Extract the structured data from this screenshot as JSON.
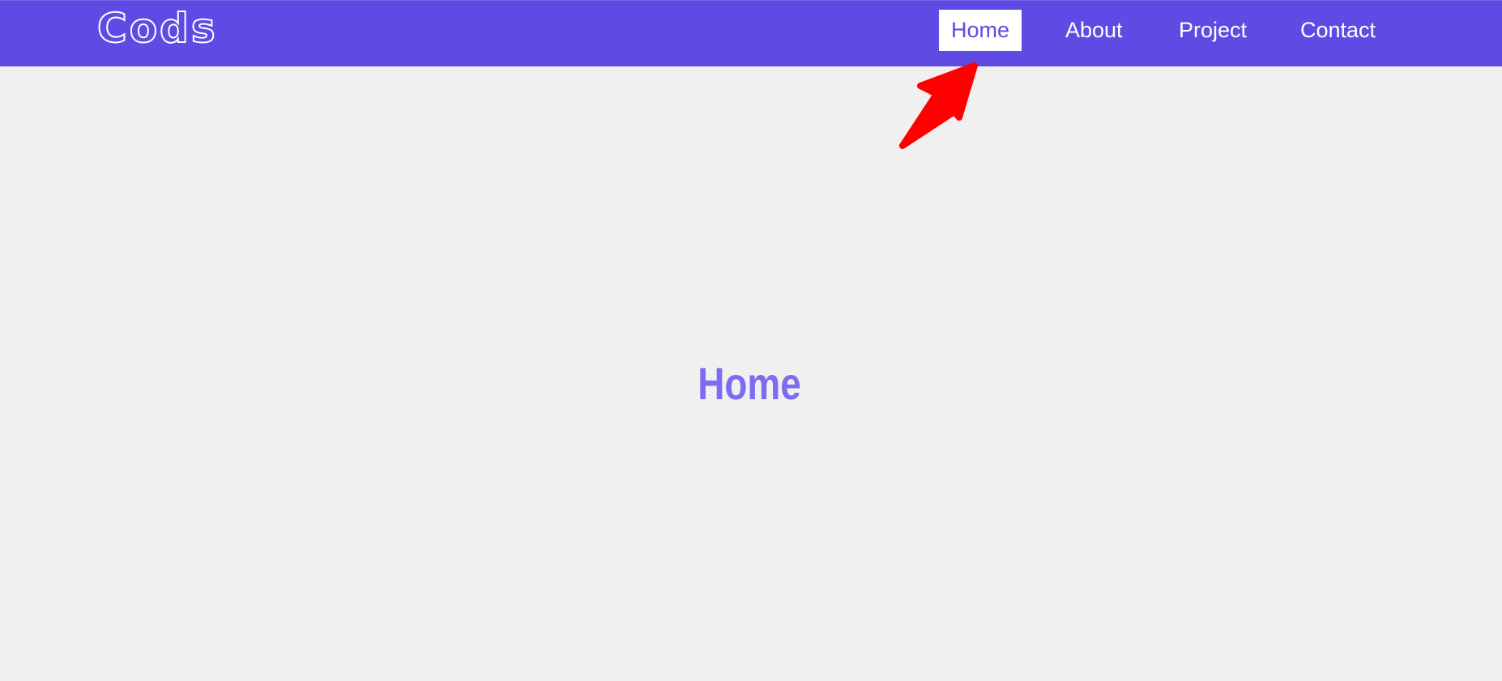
{
  "brand": {
    "logo_text": "Cods"
  },
  "nav": {
    "items": [
      {
        "label": "Home",
        "active": true
      },
      {
        "label": "About",
        "active": false
      },
      {
        "label": "Project",
        "active": false
      },
      {
        "label": "Contact",
        "active": false
      }
    ]
  },
  "main": {
    "title": "Home"
  },
  "colors": {
    "primary": "#5f4ae3",
    "heading": "#7b6cf2",
    "background": "#f0f0f0",
    "annotation_arrow": "#ff0000"
  },
  "annotation": {
    "icon": "red-arrow-icon"
  }
}
